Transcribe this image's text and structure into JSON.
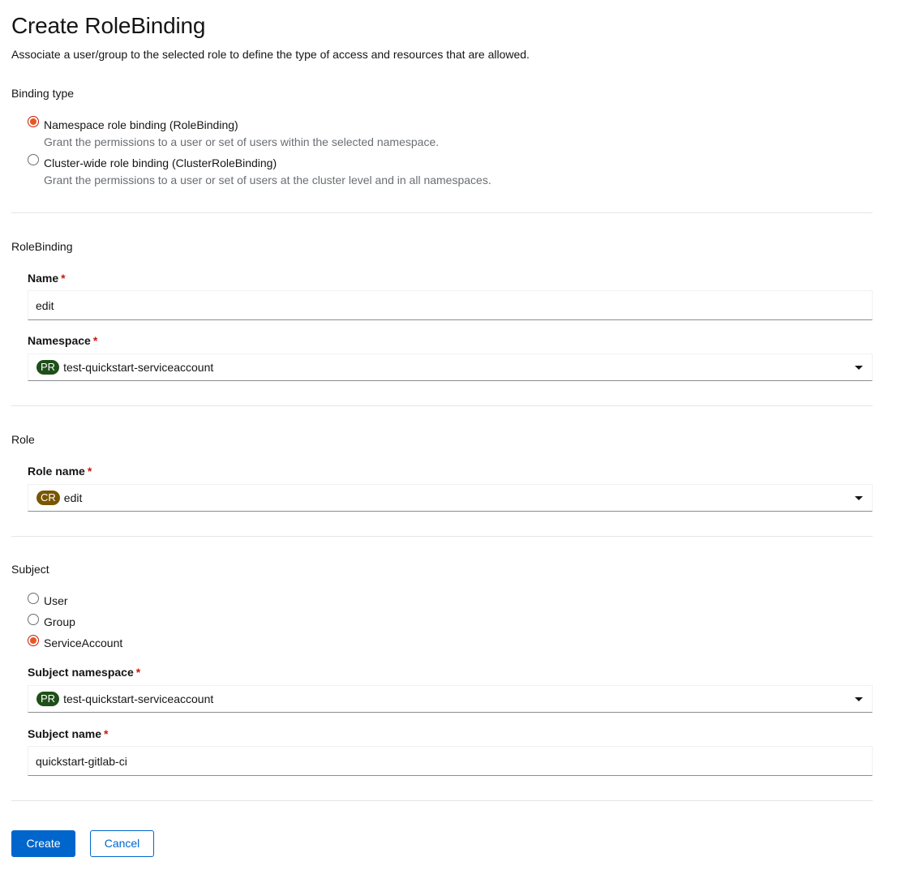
{
  "page": {
    "title": "Create RoleBinding",
    "description": "Associate a user/group to the selected role to define the type of access and resources that are allowed."
  },
  "binding_type": {
    "label": "Binding type",
    "options": [
      {
        "label": "Namespace role binding (RoleBinding)",
        "help": "Grant the permissions to a user or set of users within the selected namespace.",
        "checked": true
      },
      {
        "label": "Cluster-wide role binding (ClusterRoleBinding)",
        "help": "Grant the permissions to a user or set of users at the cluster level and in all namespaces.",
        "checked": false
      }
    ]
  },
  "rolebinding": {
    "section_title": "RoleBinding",
    "name_label": "Name",
    "name_value": "edit",
    "namespace_label": "Namespace",
    "namespace_badge": "PR",
    "namespace_value": "test-quickstart-serviceaccount"
  },
  "role": {
    "section_title": "Role",
    "role_name_label": "Role name",
    "role_badge": "CR",
    "role_value": "edit"
  },
  "subject": {
    "section_title": "Subject",
    "options": [
      {
        "label": "User",
        "checked": false
      },
      {
        "label": "Group",
        "checked": false
      },
      {
        "label": "ServiceAccount",
        "checked": true
      }
    ],
    "namespace_label": "Subject namespace",
    "namespace_badge": "PR",
    "namespace_value": "test-quickstart-serviceaccount",
    "name_label": "Subject name",
    "name_value": "quickstart-gitlab-ci"
  },
  "required_marker": "*",
  "actions": {
    "create_label": "Create",
    "cancel_label": "Cancel"
  },
  "colors": {
    "primary": "#0066cc",
    "radio_checked": "#e8571f",
    "required": "#c9190b",
    "badge_project": "#1e4f18",
    "badge_cluster_role": "#795600"
  }
}
